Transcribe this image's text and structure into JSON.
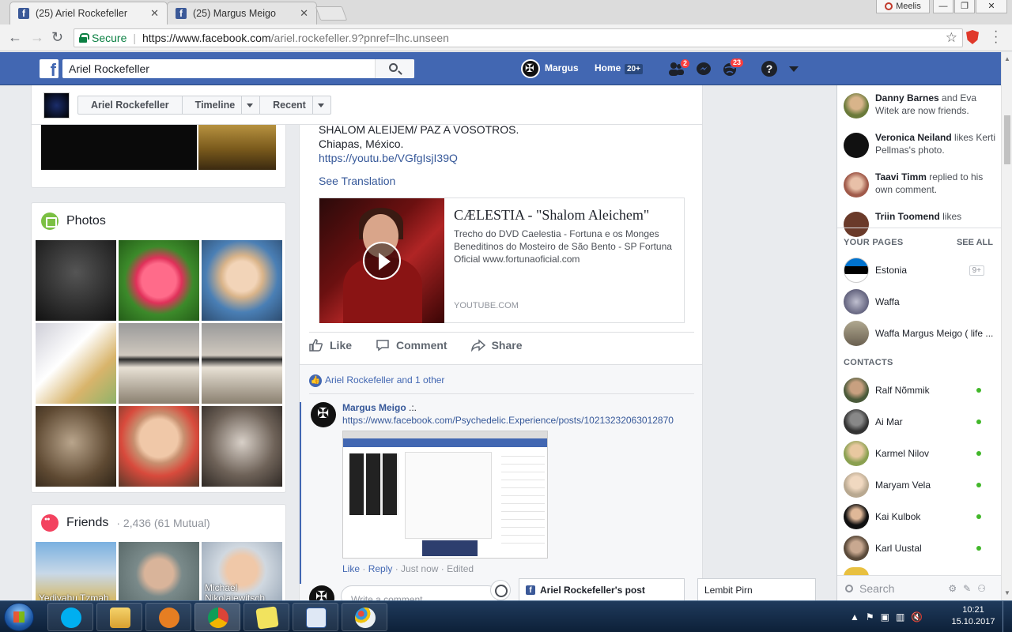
{
  "browser": {
    "tabs": [
      {
        "title": "(25) Ariel Rockefeller",
        "active": true
      },
      {
        "title": "(25) Margus Meigo",
        "active": false
      }
    ],
    "profile_user": "Meelis",
    "secure_label": "Secure",
    "url_host": "https://www.facebook.com",
    "url_path": "/ariel.rockefeller.9?pnref=lhc.unseen"
  },
  "fb_nav": {
    "search_value": "Ariel Rockefeller",
    "user": "Margus",
    "home": "Home",
    "home_badge": "20+",
    "friend_requests": "2",
    "notifications": "23",
    "help": "?"
  },
  "profile_bar": {
    "name": "Ariel Rockefeller",
    "timeline": "Timeline",
    "recent": "Recent"
  },
  "left": {
    "photos_title": "Photos",
    "friends_title": "Friends",
    "friends_count": "· 2,436 (61 Mutual)",
    "friends": [
      {
        "name": "Yedivahu Tzmah"
      },
      {
        "name": ""
      },
      {
        "name": "Michael Nikolajewitsch"
      }
    ]
  },
  "post": {
    "lines": [
      "SHALOM ALEIJEM/ PAZ A VOSOTROS.",
      "Chiapas, México."
    ],
    "url": "https://youtu.be/VGfgIsjI39Q",
    "see_translation": "See Translation",
    "card_title": "CÆLESTIA - \"Shalom Aleichem\"",
    "card_desc": "Trecho do DVD Caelestia - Fortuna e os Monges Beneditinos do Mosteiro de São Bento - SP Fortuna Oficial www.fortunaoficial.com",
    "card_domain": "YOUTUBE.COM",
    "like": "Like",
    "comment": "Comment",
    "share": "Share",
    "reactions": "Ariel Rockefeller and 1 other",
    "comment_author": "Margus Meigo",
    "comment_suffix": ".:.",
    "comment_link": "https://www.facebook.com/Psychedelic.Experience/posts/10213232063012870",
    "comment_like": "Like",
    "comment_reply": "Reply",
    "comment_time": "Just now",
    "comment_edited": "Edited",
    "write_placeholder": "Write a comment"
  },
  "sidebar": {
    "ticker": [
      {
        "name": "Danny Barnes",
        "text": " and Eva Witek are now friends."
      },
      {
        "name": "Veronica Neiland",
        "text": " likes Kerti Pellmas's photo."
      },
      {
        "name": "Taavi Timm",
        "text": " replied to his own comment."
      },
      {
        "name": "Triin Toomend",
        "text": " likes"
      }
    ],
    "your_pages": "YOUR PAGES",
    "see_all": "SEE ALL",
    "pages": [
      {
        "name": "Estonia",
        "count": "9+"
      },
      {
        "name": "Waffa",
        "count": ""
      },
      {
        "name": "Waffa Margus Meigo ( life ...",
        "count": ""
      }
    ],
    "contacts_title": "CONTACTS",
    "contacts": [
      {
        "name": "Ralf Nõmmik"
      },
      {
        "name": "Ai Mar"
      },
      {
        "name": "Karmel Nilov"
      },
      {
        "name": "Maryam Vela"
      },
      {
        "name": "Kai Kulbok"
      },
      {
        "name": "Karl Uustal"
      }
    ],
    "search_placeholder": "Search"
  },
  "chat": {
    "tab1": "Ariel Rockefeller's post",
    "tab2": "Lembit Pirn"
  },
  "taskbar": {
    "time": "10:21",
    "date": "15.10.2017"
  }
}
